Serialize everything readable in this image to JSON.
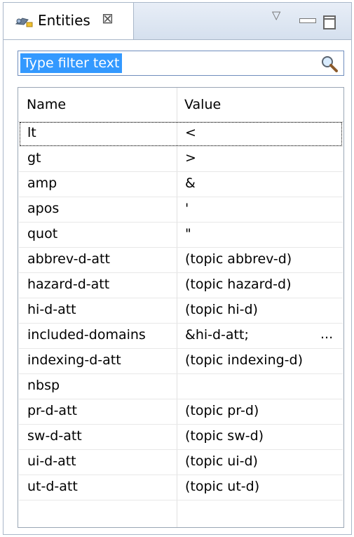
{
  "view": {
    "title": "Entities",
    "close_symbol": "⊠",
    "menu_symbol": "▽"
  },
  "filter": {
    "value": "Type filter text"
  },
  "table": {
    "columns": [
      "Name",
      "Value"
    ],
    "rows": [
      {
        "name": "lt",
        "value": "<"
      },
      {
        "name": "gt",
        "value": ">"
      },
      {
        "name": "amp",
        "value": "&"
      },
      {
        "name": "apos",
        "value": "'"
      },
      {
        "name": "quot",
        "value": "\""
      },
      {
        "name": "abbrev-d-att",
        "value": "(topic abbrev-d)"
      },
      {
        "name": "hazard-d-att",
        "value": "(topic hazard-d)"
      },
      {
        "name": "hi-d-att",
        "value": "(topic hi-d)"
      },
      {
        "name": "included-domains",
        "value": "&hi-d-att;",
        "more": "..."
      },
      {
        "name": "indexing-d-att",
        "value": "(topic indexing-d)"
      },
      {
        "name": "nbsp",
        "value": ""
      },
      {
        "name": "pr-d-att",
        "value": "(topic pr-d)"
      },
      {
        "name": "sw-d-att",
        "value": "(topic sw-d)"
      },
      {
        "name": "ui-d-att",
        "value": "(topic ui-d)"
      },
      {
        "name": "ut-d-att",
        "value": "(topic ut-d)"
      }
    ]
  },
  "icons": {
    "view_icon": "entities-view-icon",
    "search": "search-icon",
    "menu": "view-menu-icon",
    "minimize": "minimize-icon",
    "maximize": "maximize-icon"
  }
}
